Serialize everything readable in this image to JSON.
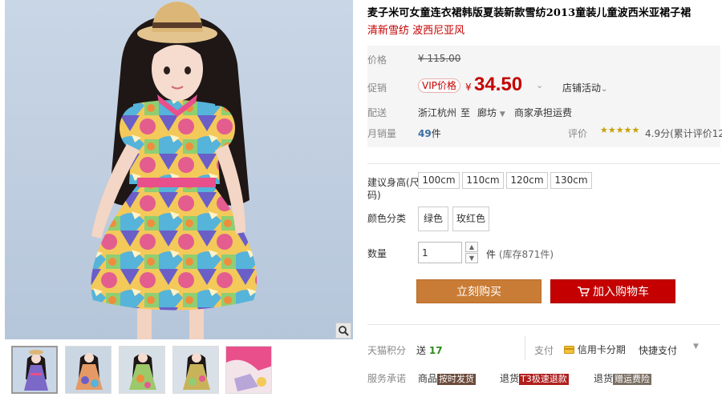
{
  "product": {
    "title": "麦子米可女童连衣裙韩版夏装新款雪纺2013童装儿童波西米亚裙子裙",
    "subtitle": "清新雪纺 波西尼亚风"
  },
  "price": {
    "label": "价格",
    "original": "¥ 115.00",
    "promo_label": "促销",
    "vip_tag": "VIP价格",
    "currency": "¥",
    "current": "34.50",
    "store_activity": "店铺活动"
  },
  "shipping": {
    "label": "配送",
    "from": "浙江杭州",
    "to_word": "至",
    "to": "廊坊",
    "fee": "商家承担运费"
  },
  "sales": {
    "label": "月销量",
    "count": "49",
    "unit": "件",
    "rating_label": "评价",
    "stars": "★★★★★",
    "rating_text": "4.9分(累计评价12"
  },
  "options": {
    "size_label": "建议身高(尺码)",
    "sizes": [
      "100cm",
      "110cm",
      "120cm",
      "130cm"
    ],
    "color_label": "颜色分类",
    "colors": [
      "绿色",
      "玫红色"
    ],
    "qty_label": "数量",
    "qty_value": "1",
    "qty_unit": "件",
    "stock": "(库存871件)"
  },
  "actions": {
    "buy_now": "立刻购买",
    "add_to_cart": "加入购物车"
  },
  "extras": {
    "points_label": "天猫积分",
    "points_prefix": "送",
    "points_value": "17",
    "pay_label": "支付",
    "pay_credit": "信用卡分期",
    "pay_quick": "快捷支付",
    "service_label": "服务承诺",
    "service_1_prefix": "商品",
    "service_1_badge": "按时发货",
    "service_2_prefix": "退货",
    "service_2_badge": "T3极速退款",
    "service_3_prefix": "退货",
    "service_3_badge": "赠运费险"
  },
  "colors_theme": {
    "price_red": "#c40000",
    "buy_orange": "#c97c35",
    "cart_red": "#c40000",
    "points_green": "#2e8b1c"
  },
  "icons": {
    "zoom": "magnifier-icon",
    "cart": "cart-icon",
    "credit": "credit-card-icon"
  }
}
